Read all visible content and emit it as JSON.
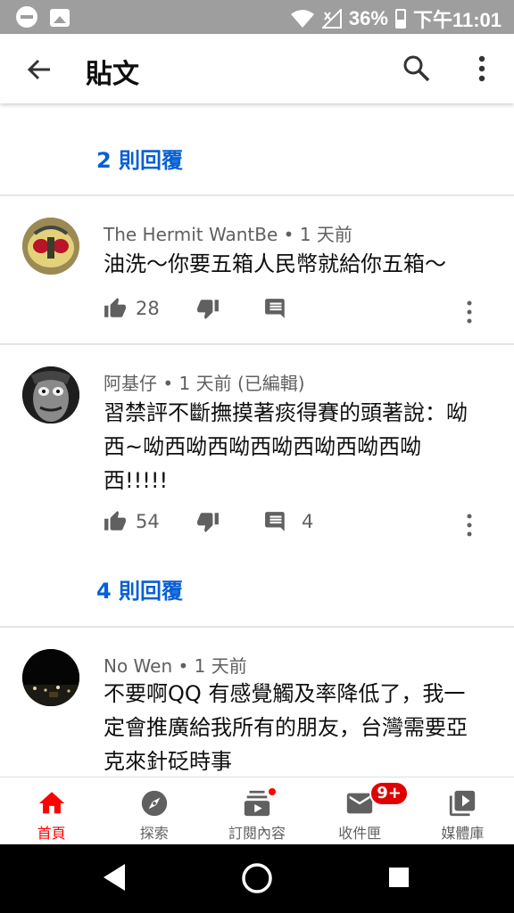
{
  "status_bar": {
    "battery": "36%",
    "time": "下午11:01",
    "icons": [
      "dnd-icon",
      "image-icon",
      "wifi-icon",
      "signal-icon",
      "battery-icon"
    ]
  },
  "app_bar": {
    "title": "貼文",
    "icons": [
      "back-arrow-icon",
      "search-icon",
      "more-vert-icon"
    ]
  },
  "thread": {
    "top_reply_link": "2 則回覆",
    "comments": [
      {
        "author": "The Hermit WantBe",
        "time": "1 天前",
        "edited": "",
        "text": "油洗～你要五箱人民幣就給你五箱～",
        "likes": "28",
        "replies": ""
      },
      {
        "author": "阿基仔",
        "time": "1 天前",
        "edited": "(已編輯)",
        "text": "習禁評不斷撫摸著痰得賽的頭著說：呦西~呦西呦西呦西呦西呦西呦西呦西!!!!!",
        "likes": "54",
        "replies": "4",
        "reply_link": "4 則回覆"
      },
      {
        "author": "No Wen",
        "time": "1 天前",
        "edited": "",
        "text": "不要啊QQ 有感覺觸及率降低了，我一定會推廣給我所有的朋友，台灣需要亞克來針砭時事"
      }
    ]
  },
  "bottom_nav": {
    "items": [
      {
        "label": "首頁",
        "icon": "home-icon",
        "active": true
      },
      {
        "label": "探索",
        "icon": "explore-icon"
      },
      {
        "label": "訂閱內容",
        "icon": "subscriptions-icon"
      },
      {
        "label": "收件匣",
        "icon": "inbox-icon",
        "badge": "9+"
      },
      {
        "label": "媒體庫",
        "icon": "library-icon"
      }
    ]
  },
  "colors": {
    "accent_red": "#ff0000",
    "link_blue": "#065fd4",
    "secondary_text": "#606060",
    "status_bar": "#9e9e9e"
  }
}
